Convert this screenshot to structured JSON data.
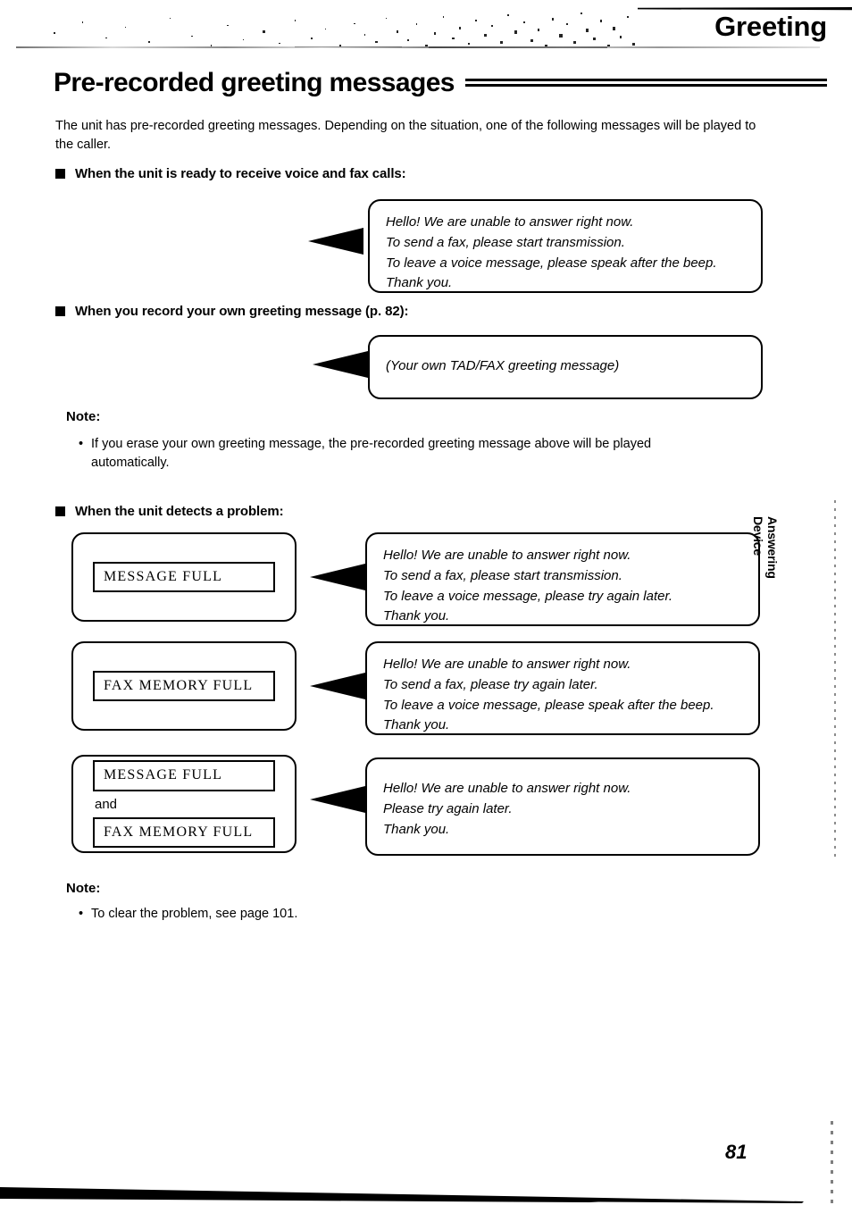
{
  "header": {
    "chapter_title": "Greeting",
    "side_tab_line1": "Answering",
    "side_tab_line2": "Device"
  },
  "page_heading": "Pre-recorded greeting messages",
  "intro": "The unit has pre-recorded greeting messages. Depending on the situation, one of the following messages will be played to the caller.",
  "sections": [
    {
      "heading": "When the unit is ready to receive voice and fax calls:",
      "bubble": [
        "Hello! We are unable to answer right now.",
        "To send a fax, please start transmission.",
        "To leave a voice message, please speak after the beep.",
        "Thank you."
      ]
    },
    {
      "heading": "When you record your own greeting message (p. 82):",
      "bubble": [
        "(Your own TAD/FAX greeting message)"
      ]
    },
    {
      "heading": "When the unit detects a problem:"
    }
  ],
  "note1": {
    "title": "Note:",
    "bullet": "•",
    "text": "If you erase your own greeting message, the pre-recorded greeting message above will be played automatically."
  },
  "problem_rows": [
    {
      "lcd": [
        "MESSAGE FULL"
      ],
      "and_label": "",
      "bubble": [
        "Hello! We are unable to answer right now.",
        "To send a fax, please start transmission.",
        "To leave a voice message, please try again later.",
        "Thank you."
      ]
    },
    {
      "lcd": [
        "FAX MEMORY FULL"
      ],
      "and_label": "",
      "bubble": [
        "Hello! We are unable to answer right now.",
        "To send a fax, please try again later.",
        "To leave a voice message, please speak after the beep.",
        "Thank you."
      ]
    },
    {
      "lcd": [
        "MESSAGE FULL",
        "FAX MEMORY FULL"
      ],
      "and_label": "and",
      "bubble": [
        "Hello! We are unable to answer right now.",
        "Please try again later.",
        "Thank you."
      ]
    }
  ],
  "note2": {
    "title": "Note:",
    "bullet": "•",
    "text": "To clear the problem, see page 101."
  },
  "page_number": "81",
  "colors": {
    "ink": "#000000",
    "paper": "#ffffff"
  }
}
